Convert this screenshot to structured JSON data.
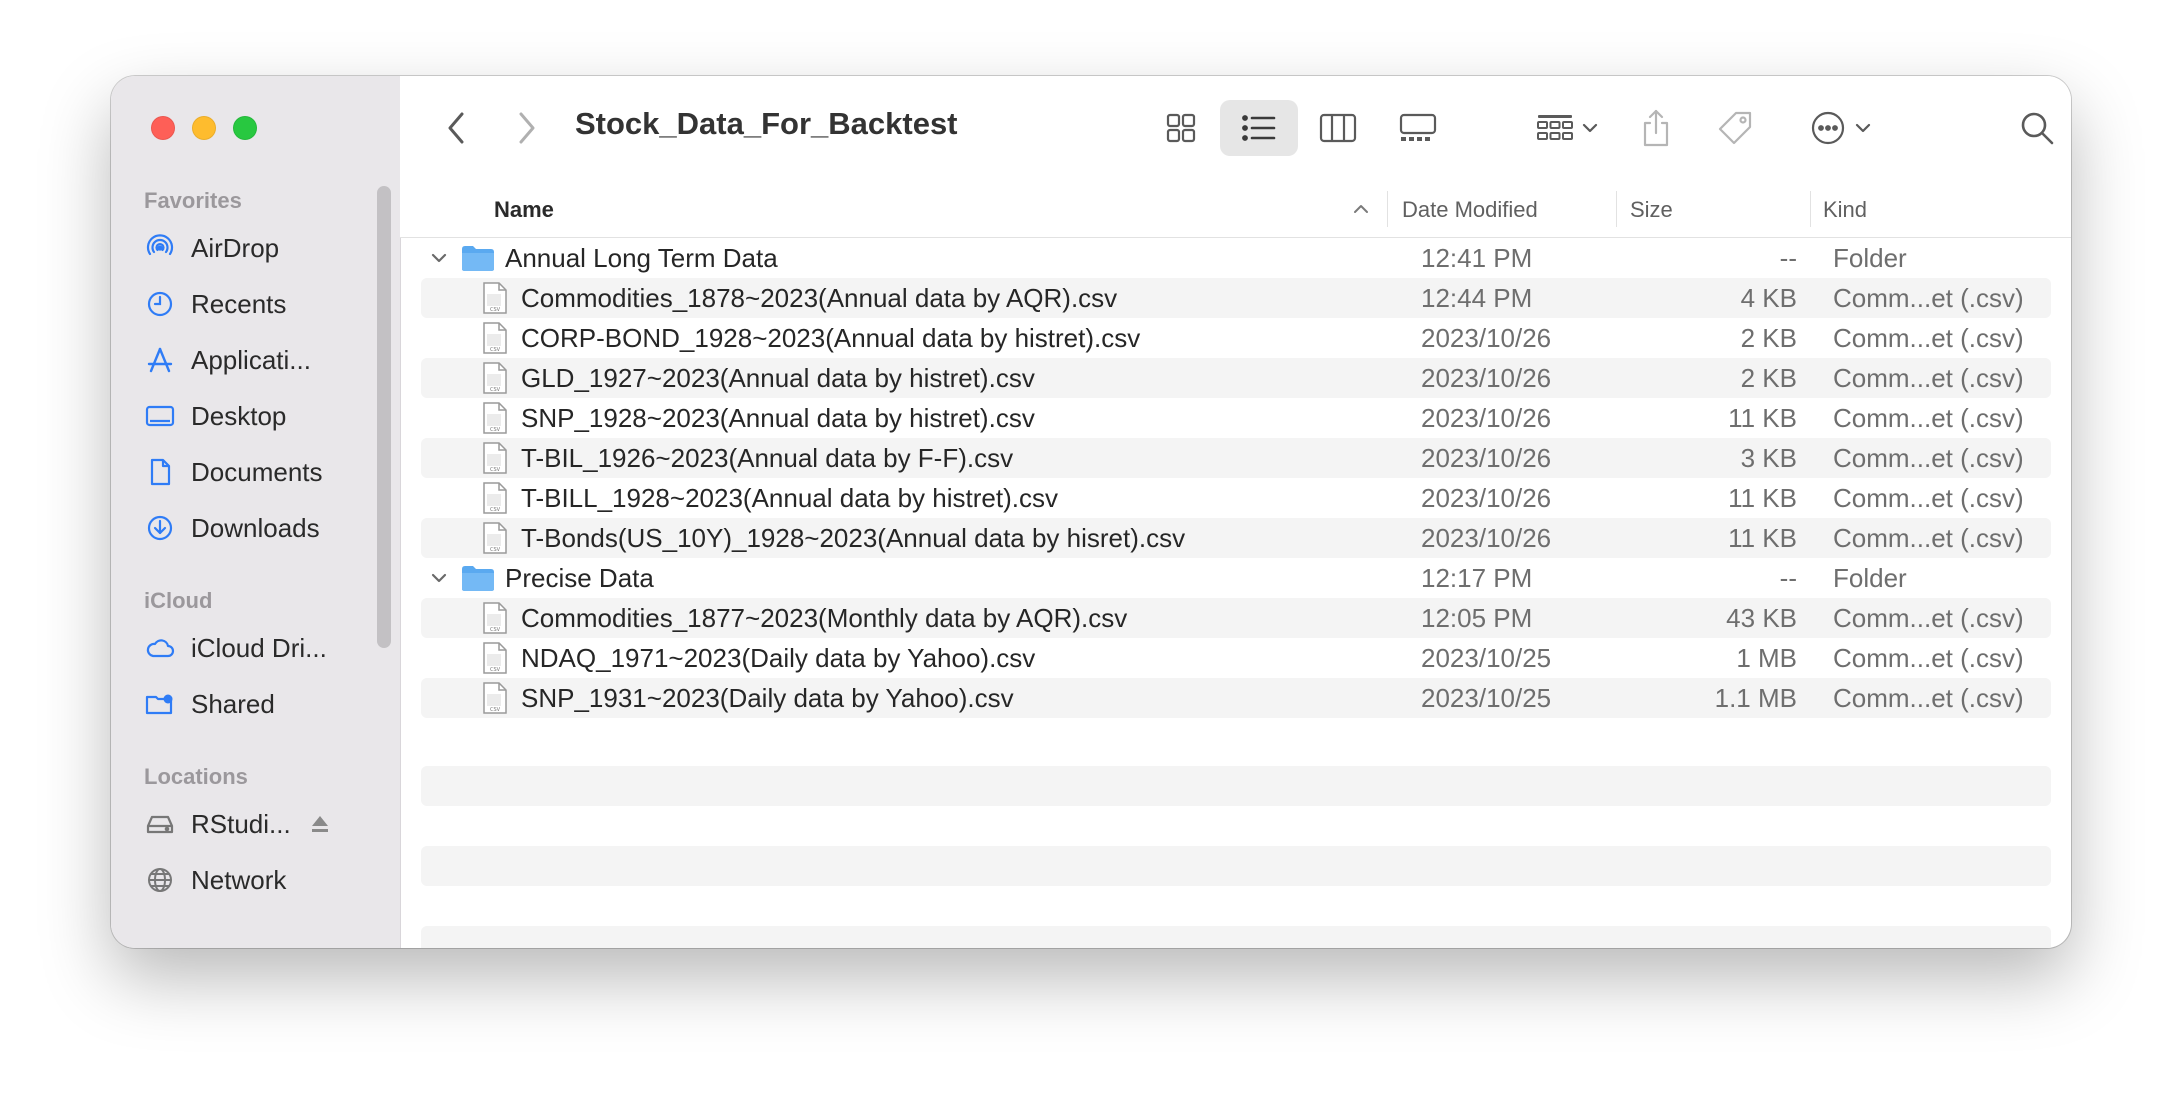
{
  "window": {
    "title": "Stock_Data_For_Backtest"
  },
  "sidebar": {
    "sections": [
      {
        "label": "Favorites"
      },
      {
        "label": "iCloud"
      },
      {
        "label": "Locations"
      }
    ],
    "favorites": [
      {
        "label": "AirDrop",
        "icon": "airdrop-icon"
      },
      {
        "label": "Recents",
        "icon": "clock-icon"
      },
      {
        "label": "Applicati...",
        "icon": "applications-icon"
      },
      {
        "label": "Desktop",
        "icon": "desktop-icon"
      },
      {
        "label": "Documents",
        "icon": "document-icon"
      },
      {
        "label": "Downloads",
        "icon": "download-icon"
      }
    ],
    "icloud": [
      {
        "label": "iCloud Dri...",
        "icon": "cloud-icon"
      },
      {
        "label": "Shared",
        "icon": "shared-folder-icon"
      }
    ],
    "locations": [
      {
        "label": "RStudi...",
        "icon": "drive-icon"
      },
      {
        "label": "Network",
        "icon": "globe-icon"
      }
    ]
  },
  "columns": {
    "name": "Name",
    "date": "Date Modified",
    "size": "Size",
    "kind": "Kind"
  },
  "rows": [
    {
      "type": "folder",
      "name": "Annual Long Term Data",
      "date": "12:41 PM",
      "size": "--",
      "kind": "Folder"
    },
    {
      "type": "file",
      "name": "Commodities_1878~2023(Annual data by AQR).csv",
      "date": "12:44 PM",
      "size": "4 KB",
      "kind": "Comm...et (.csv)"
    },
    {
      "type": "file",
      "name": "CORP-BOND_1928~2023(Annual data by histret).csv",
      "date": "2023/10/26",
      "size": "2 KB",
      "kind": "Comm...et (.csv)"
    },
    {
      "type": "file",
      "name": "GLD_1927~2023(Annual data by histret).csv",
      "date": "2023/10/26",
      "size": "2 KB",
      "kind": "Comm...et (.csv)"
    },
    {
      "type": "file",
      "name": "SNP_1928~2023(Annual data by histret).csv",
      "date": "2023/10/26",
      "size": "11 KB",
      "kind": "Comm...et (.csv)"
    },
    {
      "type": "file",
      "name": "T-BIL_1926~2023(Annual data by F-F).csv",
      "date": "2023/10/26",
      "size": "3 KB",
      "kind": "Comm...et (.csv)"
    },
    {
      "type": "file",
      "name": "T-BILL_1928~2023(Annual data by histret).csv",
      "date": "2023/10/26",
      "size": "11 KB",
      "kind": "Comm...et (.csv)"
    },
    {
      "type": "file",
      "name": "T-Bonds(US_10Y)_1928~2023(Annual data by hisret).csv",
      "date": "2023/10/26",
      "size": "11 KB",
      "kind": "Comm...et (.csv)"
    },
    {
      "type": "folder",
      "name": "Precise Data",
      "date": "12:17 PM",
      "size": "--",
      "kind": "Folder"
    },
    {
      "type": "file",
      "name": "Commodities_1877~2023(Monthly data by AQR).csv",
      "date": "12:05 PM",
      "size": "43 KB",
      "kind": "Comm...et (.csv)"
    },
    {
      "type": "file",
      "name": "NDAQ_1971~2023(Daily data by Yahoo).csv",
      "date": "2023/10/25",
      "size": "1 MB",
      "kind": "Comm...et (.csv)"
    },
    {
      "type": "file",
      "name": "SNP_1931~2023(Daily data by Yahoo).csv",
      "date": "2023/10/25",
      "size": "1.1 MB",
      "kind": "Comm...et (.csv)"
    }
  ],
  "colors": {
    "accent": "#2f7cf6",
    "folder": "#5aa9f0",
    "close": "#fe5f57",
    "minimize": "#febc2e",
    "zoom": "#28c840"
  }
}
